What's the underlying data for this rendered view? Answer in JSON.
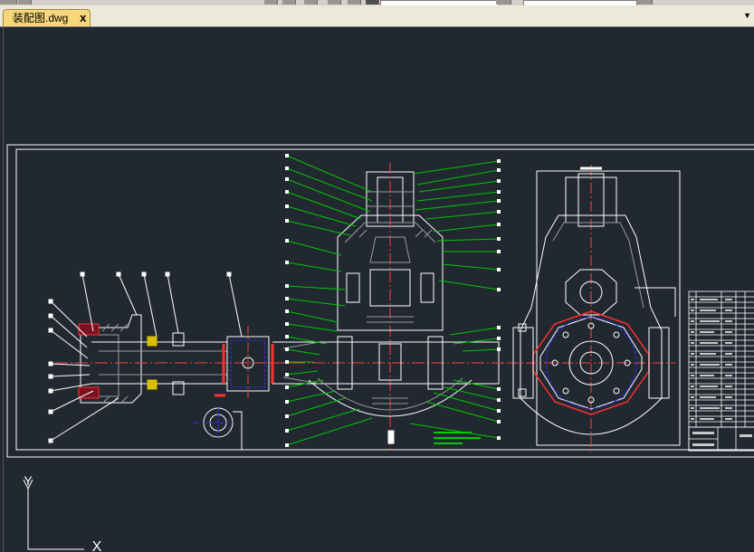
{
  "window": {
    "tab": {
      "title": "装配图.dwg",
      "close_glyph": "x"
    },
    "tab_menu_glyph": "▼"
  },
  "drawing": {
    "ucs_y_label": "Y",
    "ucs_x_label": "X",
    "colors": {
      "background": "#212830",
      "frame": "#ffffff",
      "leader": "#00c800",
      "center": "#ff4040",
      "hidden": "#3030ff",
      "part": "#ffffff",
      "hatch": "#9a9a9a"
    }
  }
}
